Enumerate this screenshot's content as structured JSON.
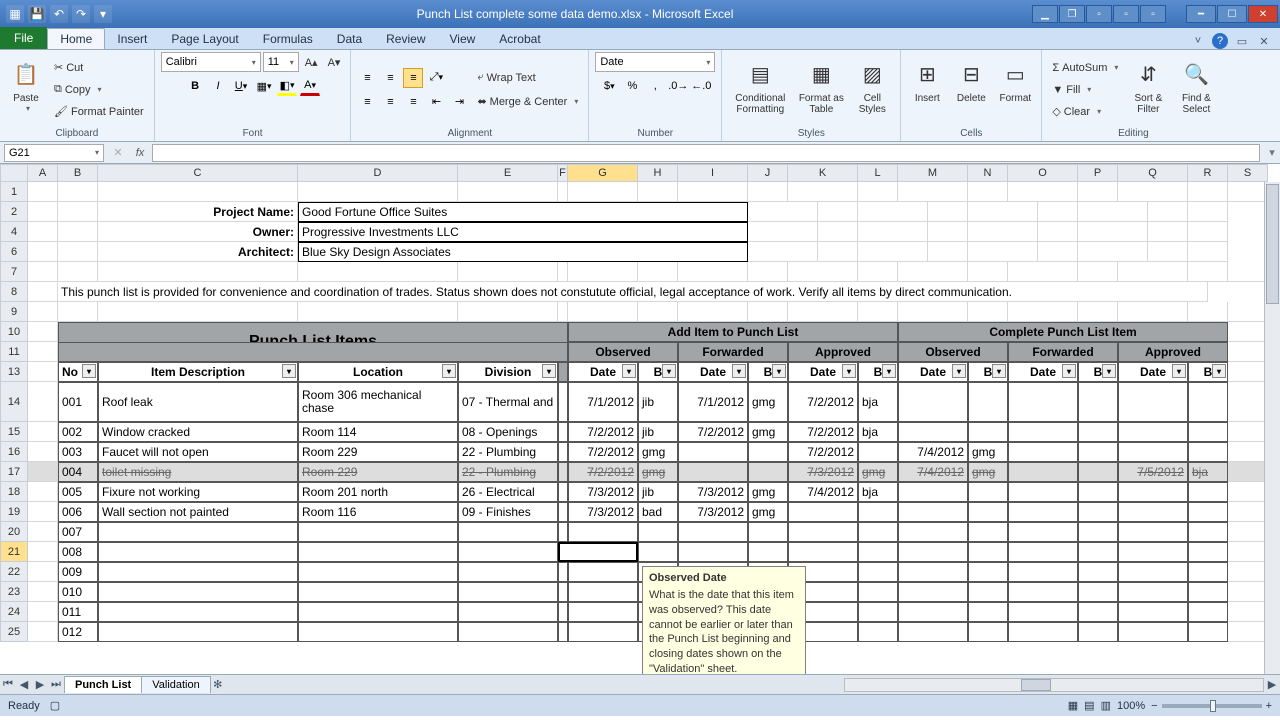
{
  "window": {
    "title": "Punch List complete some data demo.xlsx - Microsoft Excel"
  },
  "tabs": {
    "file": "File",
    "home": "Home",
    "insert": "Insert",
    "pagelayout": "Page Layout",
    "formulas": "Formulas",
    "data": "Data",
    "review": "Review",
    "view": "View",
    "acrobat": "Acrobat"
  },
  "ribbon": {
    "clipboard": {
      "label": "Clipboard",
      "paste": "Paste",
      "cut": "Cut",
      "copy": "Copy",
      "formatpainter": "Format Painter"
    },
    "font": {
      "label": "Font",
      "name": "Calibri",
      "size": "11"
    },
    "alignment": {
      "label": "Alignment",
      "wrap": "Wrap Text",
      "merge": "Merge & Center"
    },
    "number": {
      "label": "Number",
      "format": "Date"
    },
    "styles": {
      "label": "Styles",
      "cond": "Conditional Formatting",
      "fat": "Format as Table",
      "cs": "Cell Styles"
    },
    "cells": {
      "label": "Cells",
      "insert": "Insert",
      "delete": "Delete",
      "format": "Format"
    },
    "editing": {
      "label": "Editing",
      "autosum": "AutoSum",
      "fill": "Fill",
      "clear": "Clear",
      "sort": "Sort & Filter",
      "find": "Find & Select"
    }
  },
  "namebox": "G21",
  "columns": [
    "A",
    "B",
    "C",
    "D",
    "E",
    "F",
    "G",
    "H",
    "I",
    "J",
    "K",
    "L",
    "M",
    "N",
    "O",
    "P",
    "Q",
    "R",
    "S"
  ],
  "colwidths": [
    "cA",
    "cB",
    "cC",
    "cD",
    "cE",
    "cF",
    "cG",
    "cH",
    "cI",
    "cJ",
    "cK",
    "cL",
    "cM",
    "cN",
    "cO",
    "cP",
    "cQ",
    "cR",
    "cS"
  ],
  "header": {
    "project_label": "Project Name:",
    "project_value": "Good Fortune Office Suites",
    "owner_label": "Owner:",
    "owner_value": "Progressive Investments LLC",
    "architect_label": "Architect:",
    "architect_value": "Blue Sky Design Associates",
    "disclaimer": "This punch list is provided for convenience and coordination of trades. Status shown does not constutute official, legal acceptance of work.  Verify all items by direct communication."
  },
  "table": {
    "title": "Punch List Items",
    "add_title": "Add Item to Punch List",
    "complete_title": "Complete Punch List Item",
    "sub_observed": "Observed",
    "sub_forwarded": "Forwarded",
    "sub_approved": "Approved",
    "col_no": "No",
    "col_desc": "Item Description",
    "col_loc": "Location",
    "col_div": "Division",
    "col_date": "Date",
    "col_by": "B",
    "rows": [
      {
        "no": "001",
        "desc": "Roof leak",
        "loc": "Room 306 mechanical chase",
        "div": "07 - Thermal and",
        "a_obs_d": "7/1/2012",
        "a_obs_b": "jib",
        "a_fwd_d": "7/1/2012",
        "a_fwd_b": "gmg",
        "a_app_d": "7/2/2012",
        "a_app_b": "bja",
        "c_obs_d": "",
        "c_obs_b": "",
        "c_fwd_d": "",
        "c_fwd_b": "",
        "c_app_d": "",
        "c_app_b": "",
        "strike": false
      },
      {
        "no": "002",
        "desc": "Window cracked",
        "loc": "Room 114",
        "div": "08 - Openings",
        "a_obs_d": "7/2/2012",
        "a_obs_b": "jib",
        "a_fwd_d": "7/2/2012",
        "a_fwd_b": "gmg",
        "a_app_d": "7/2/2012",
        "a_app_b": "bja",
        "c_obs_d": "",
        "c_obs_b": "",
        "c_fwd_d": "",
        "c_fwd_b": "",
        "c_app_d": "",
        "c_app_b": "",
        "strike": false
      },
      {
        "no": "003",
        "desc": "Faucet will not open",
        "loc": "Room 229",
        "div": "22 - Plumbing",
        "a_obs_d": "7/2/2012",
        "a_obs_b": "gmg",
        "a_fwd_d": "",
        "a_fwd_b": "",
        "a_app_d": "7/2/2012",
        "a_app_b": "",
        "c_obs_d": "7/4/2012",
        "c_obs_b": "gmg",
        "c_fwd_d": "",
        "c_fwd_b": "",
        "c_app_d": "",
        "c_app_b": "",
        "strike": false
      },
      {
        "no": "004",
        "desc": "toilet missing",
        "loc": "Room 229",
        "div": "22 - Plumbing",
        "a_obs_d": "7/2/2012",
        "a_obs_b": "gmg",
        "a_fwd_d": "",
        "a_fwd_b": "",
        "a_app_d": "7/3/2012",
        "a_app_b": "gmg",
        "c_obs_d": "7/4/2012",
        "c_obs_b": "gmg",
        "c_fwd_d": "",
        "c_fwd_b": "",
        "c_app_d": "7/5/2012",
        "c_app_b": "bja",
        "strike": true
      },
      {
        "no": "005",
        "desc": "Fixure not working",
        "loc": "Room 201 north",
        "div": "26 - Electrical",
        "a_obs_d": "7/3/2012",
        "a_obs_b": "jib",
        "a_fwd_d": "7/3/2012",
        "a_fwd_b": "gmg",
        "a_app_d": "7/4/2012",
        "a_app_b": "bja",
        "c_obs_d": "",
        "c_obs_b": "",
        "c_fwd_d": "",
        "c_fwd_b": "",
        "c_app_d": "",
        "c_app_b": "",
        "strike": false
      },
      {
        "no": "006",
        "desc": "Wall section not painted",
        "loc": "Room 116",
        "div": "09 - Finishes",
        "a_obs_d": "7/3/2012",
        "a_obs_b": "bad",
        "a_fwd_d": "7/3/2012",
        "a_fwd_b": "gmg",
        "a_app_d": "",
        "a_app_b": "",
        "c_obs_d": "",
        "c_obs_b": "",
        "c_fwd_d": "",
        "c_fwd_b": "",
        "c_app_d": "",
        "c_app_b": "",
        "strike": false
      }
    ],
    "empty_nos": [
      "007",
      "008",
      "009",
      "010",
      "011",
      "012"
    ]
  },
  "tooltip": {
    "title": "Observed Date",
    "body": "What is the date that this item was observed? This date cannot be earlier or later than the Punch List beginning and closing dates shown on the \"Validation\" sheet."
  },
  "sheets": {
    "active": "Punch List",
    "other": "Validation"
  },
  "status": {
    "ready": "Ready",
    "zoom": "100%"
  }
}
